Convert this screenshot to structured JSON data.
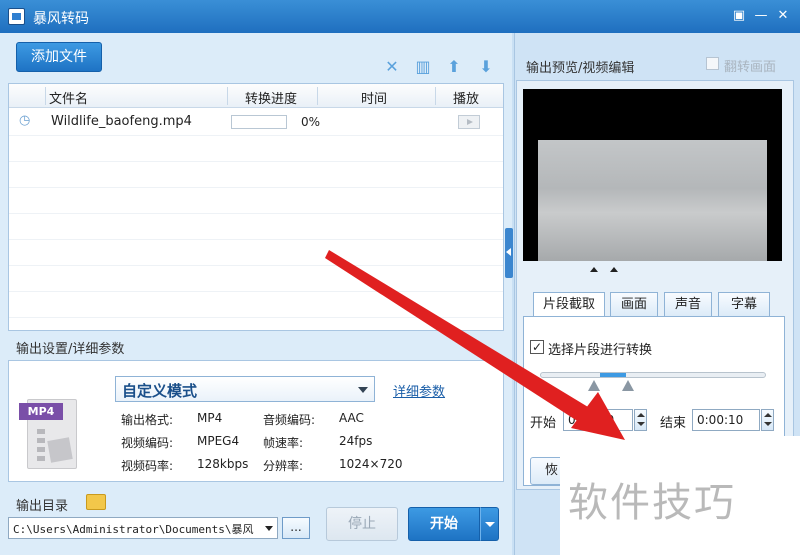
{
  "window": {
    "title": "暴风转码"
  },
  "toolbar": {
    "add_file": "添加文件"
  },
  "list": {
    "headers": [
      "文件名",
      "转换进度",
      "时间",
      "播放"
    ],
    "rows": [
      {
        "name": "Wildlife_baofeng.mp4",
        "progress": "0%",
        "progress_value": 0,
        "time": ""
      }
    ]
  },
  "settings": {
    "label": "输出设置/详细参数",
    "format_badge": "MP4",
    "mode": "自定义模式",
    "detail_link": "详细参数",
    "info": [
      {
        "k": "输出格式:",
        "v": "MP4"
      },
      {
        "k": "音频编码:",
        "v": "AAC"
      },
      {
        "k": "视频编码:",
        "v": "MPEG4"
      },
      {
        "k": "帧速率:",
        "v": "24fps"
      },
      {
        "k": "视频码率:",
        "v": "128kbps"
      },
      {
        "k": "分辨率:",
        "v": "1024×720"
      }
    ]
  },
  "output": {
    "dir_label": "输出目录",
    "path": "C:\\Users\\Administrator\\Documents\\暴风",
    "browse": "...",
    "stop": "停止",
    "start": "开始"
  },
  "preview": {
    "label": "输出预览/视频编辑",
    "flip": "翻转画面",
    "tabs": [
      "片段截取",
      "画面",
      "声音",
      "字幕"
    ],
    "segment_check": "选择片段进行转换",
    "start_label": "开始",
    "start_time": "0:00:00",
    "end_label": "结束",
    "end_time": "0:00:10",
    "restore": "恢"
  },
  "watermark": "软件技巧",
  "colors": {
    "accent": "#1e73c4",
    "arrow": "#e02020"
  }
}
